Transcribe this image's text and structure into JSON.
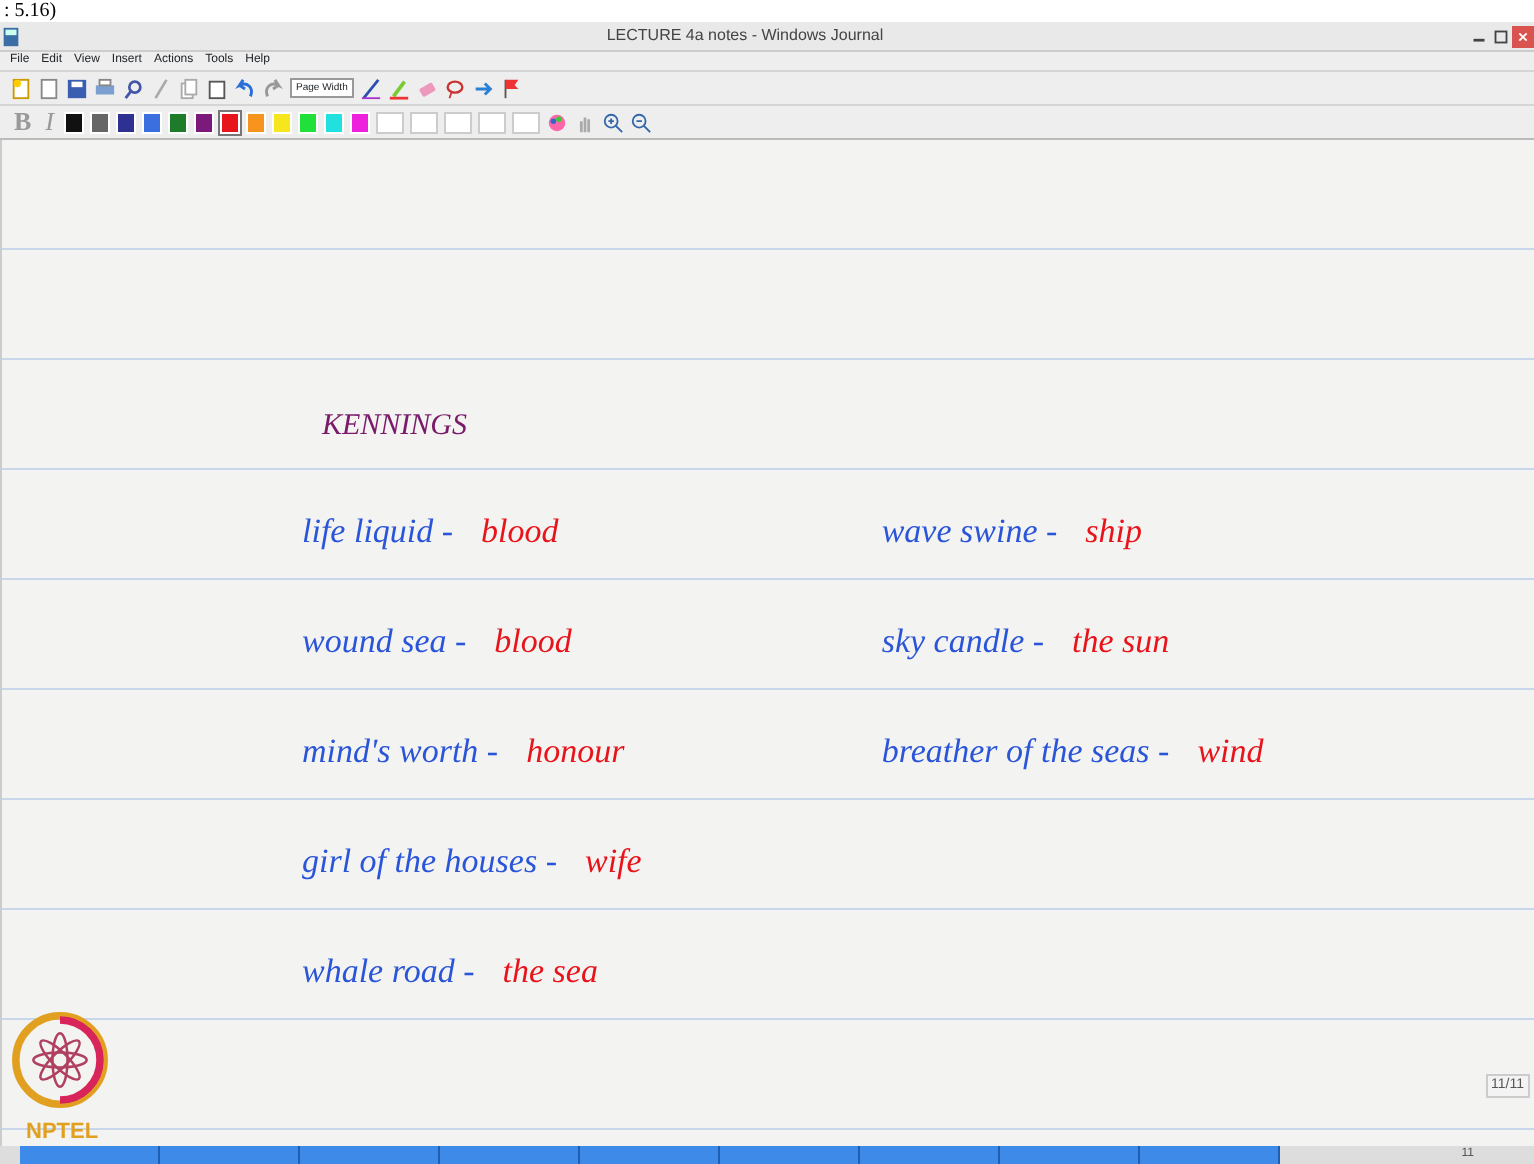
{
  "caption": ": 5.16)",
  "window": {
    "title": "LECTURE 4a notes - Windows Journal"
  },
  "menu": [
    "File",
    "Edit",
    "View",
    "Insert",
    "Actions",
    "Tools",
    "Help"
  ],
  "toolbar": {
    "zoom": "Page Width"
  },
  "format_bar": {
    "bold": "B",
    "italic": "I",
    "swatches": [
      {
        "color": "#111111",
        "selected": false
      },
      {
        "color": "#666666",
        "selected": false
      },
      {
        "color": "#2e3192",
        "selected": false
      },
      {
        "color": "#3b6fe0",
        "selected": false
      },
      {
        "color": "#1e7b2a",
        "selected": false
      },
      {
        "color": "#7b1a7b",
        "selected": false
      },
      {
        "color": "#e8141b",
        "selected": true
      },
      {
        "color": "#f7941d",
        "selected": false
      },
      {
        "color": "#f5e61e",
        "selected": false
      },
      {
        "color": "#22e03a",
        "selected": false
      },
      {
        "color": "#21e0e0",
        "selected": false
      },
      {
        "color": "#ee22dd",
        "selected": false
      }
    ]
  },
  "note": {
    "heading": "KENNINGS",
    "left": [
      {
        "term": "life liquid -",
        "meaning": "blood"
      },
      {
        "term": "wound sea -",
        "meaning": "blood"
      },
      {
        "term": "mind's worth -",
        "meaning": "honour"
      },
      {
        "term": "girl of the houses -",
        "meaning": "wife"
      },
      {
        "term": "whale road -",
        "meaning": "the sea"
      }
    ],
    "right": [
      {
        "term": "wave swine -",
        "meaning": "ship"
      },
      {
        "term": "sky candle -",
        "meaning": "the sun"
      },
      {
        "term": "breather of the seas -",
        "meaning": "wind"
      }
    ]
  },
  "page_counter": "11/11",
  "logo_text": "NPTEL",
  "taskbar_page": "11"
}
